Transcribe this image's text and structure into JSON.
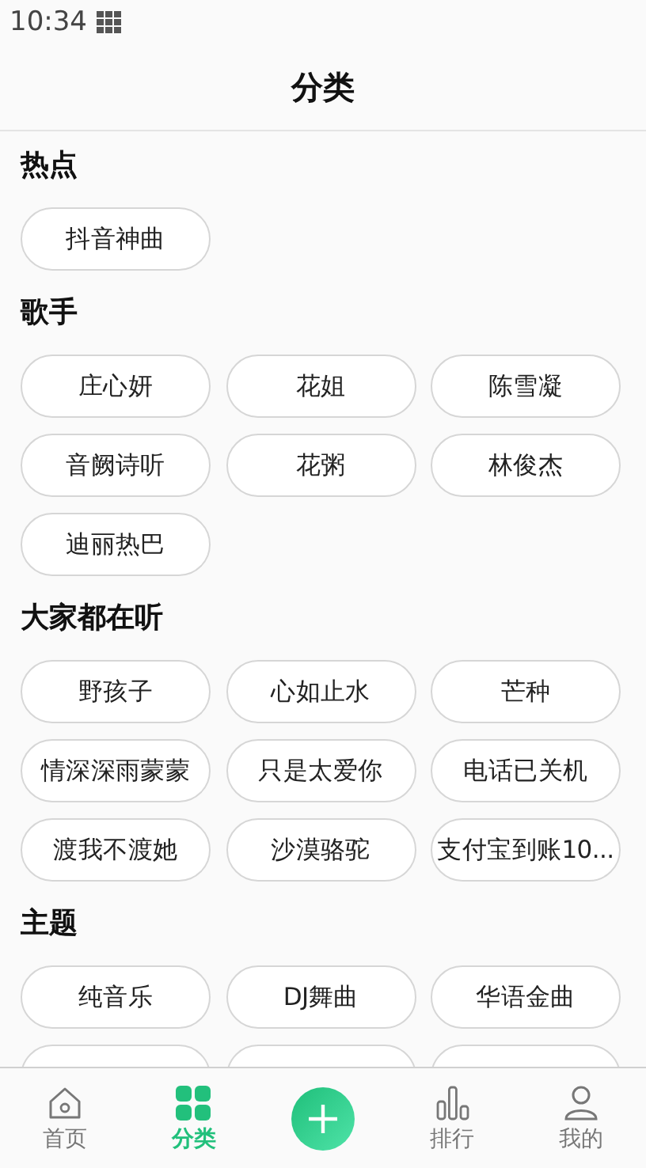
{
  "status_bar": {
    "time": "10:34"
  },
  "header": {
    "title": "分类"
  },
  "sections": [
    {
      "title": "热点",
      "tags": [
        "抖音神曲"
      ]
    },
    {
      "title": "歌手",
      "tags": [
        "庄心妍",
        "花姐",
        "陈雪凝",
        "音阙诗听",
        "花粥",
        "林俊杰",
        "迪丽热巴"
      ]
    },
    {
      "title": "大家都在听",
      "tags": [
        "野孩子",
        "心如止水",
        "芒种",
        "情深深雨蒙蒙",
        "只是太爱你",
        "电话已关机",
        "渡我不渡她",
        "沙漠骆驼",
        "支付宝到账10..."
      ]
    },
    {
      "title": "主题",
      "tags": [
        "纯音乐",
        "DJ舞曲",
        "华语金曲"
      ],
      "hidden_row": true
    }
  ],
  "nav": [
    {
      "kind": "home",
      "label": "首页",
      "selected": false
    },
    {
      "kind": "category",
      "label": "分类",
      "selected": true
    },
    {
      "kind": "add"
    },
    {
      "kind": "rank",
      "label": "排行",
      "selected": false
    },
    {
      "kind": "mine",
      "label": "我的",
      "selected": false
    }
  ]
}
